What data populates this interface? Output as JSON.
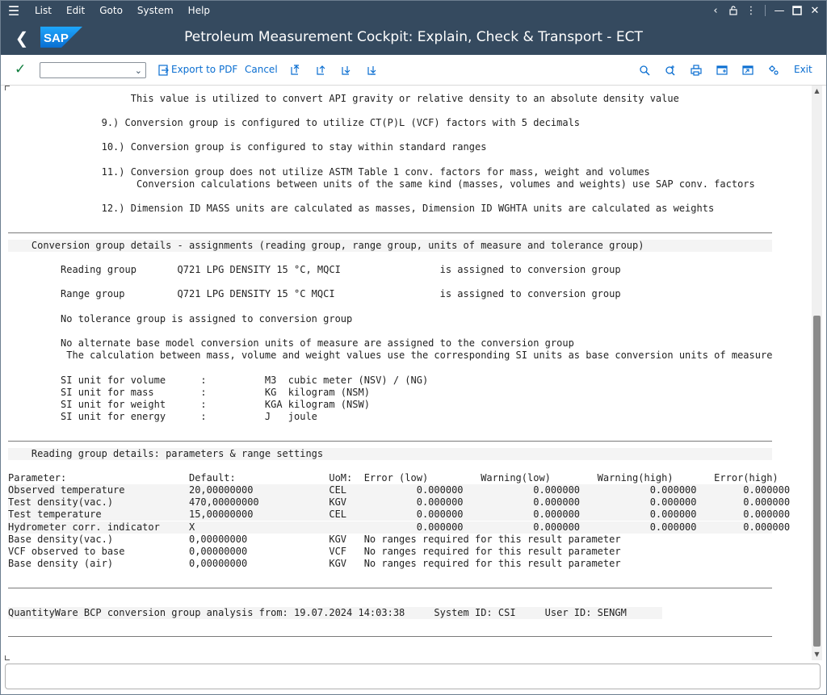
{
  "menu": {
    "items": [
      "List",
      "Edit",
      "Goto",
      "System",
      "Help"
    ]
  },
  "title": "Petroleum Measurement Cockpit: Explain, Check & Transport - ECT",
  "logo_text": "SAP",
  "toolbar": {
    "export_label": "Export to PDF",
    "cancel_label": "Cancel",
    "exit_label": "Exit"
  },
  "report": {
    "lines": [
      "                     This value is utilized to convert API gravity or relative density to an absolute density value",
      "                9.) Conversion group is configured to utilize CT(P)L (VCF) factors with 5 decimals",
      "                10.) Conversion group is configured to stay within standard ranges",
      "                11.) Conversion group does not utilize ASTM Table 1 conv. factors for mass, weight and volumes",
      "                      Conversion calculations between units of the same kind (masses, volumes and weights) use SAP conv. factors",
      "                12.) Dimension ID MASS units are calculated as masses, Dimension ID WGHTA units are calculated as weights",
      "    Conversion group details - assignments (reading group, range group, units of measure and tolerance group)",
      "         Reading group       Q721 LPG DENSITY 15 °C, MQCI                 is assigned to conversion group",
      "         Range group         Q721 LPG DENSITY 15 °C MQCI                  is assigned to conversion group",
      "         No tolerance group is assigned to conversion group",
      "         No alternate base model conversion units of measure are assigned to the conversion group",
      "          The calculation between mass, volume and weight values use the corresponding SI units as base conversion units of measure",
      "         SI unit for volume      :          M3  cubic meter (NSV) / (NG)",
      "         SI unit for mass        :          KG  kilogram (NSM)",
      "         SI unit for weight      :          KGA kilogram (NSW)",
      "         SI unit for energy      :          J   joule",
      "    Reading group details: parameters & range settings",
      "Parameter:                     Default:                UoM:  Error (low)         Warning(low)        Warning(high)       Error(high)",
      "Observed temperature           20,00000000             CEL            0.000000            0.000000            0.000000        0.000000",
      "Test density(vac.)             470,00000000            KGV            0.000000            0.000000            0.000000        0.000000",
      "Test temperature               15,00000000             CEL            0.000000            0.000000            0.000000        0.000000",
      "Hydrometer corr. indicator     X                                      0.000000            0.000000            0.000000        0.000000",
      "Base density(vac.)             0,00000000              KGV   No ranges required for this result parameter",
      "VCF observed to base           0,00000000              VCF   No ranges required for this result parameter",
      "Base density (air)             0,00000000              KGV   No ranges required for this result parameter",
      "QuantityWare BCP conversion group analysis from: 19.07.2024 14:03:38     System ID: CSI     User ID: SENGM"
    ]
  }
}
